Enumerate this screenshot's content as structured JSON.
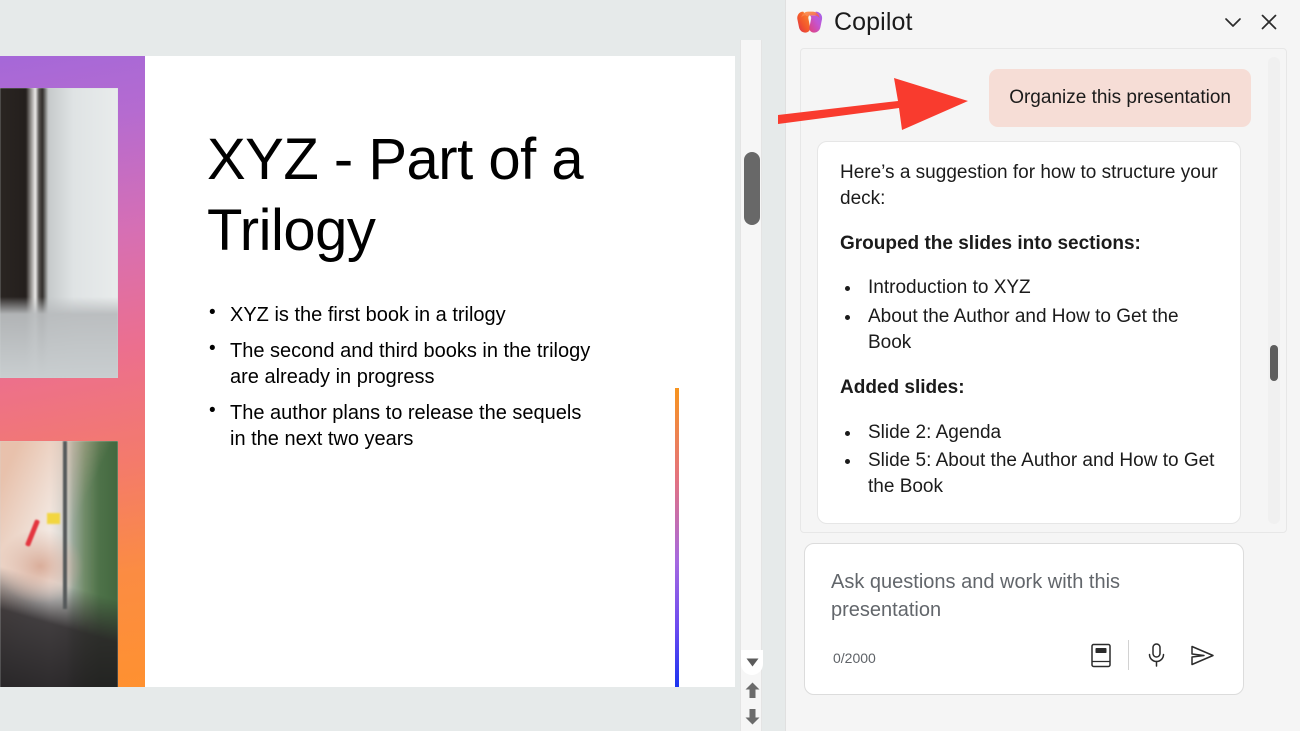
{
  "slide": {
    "title": "XYZ - Part of a Trilogy",
    "bullets": [
      "XYZ is the first book in a trilogy",
      "The second and third books in the trilogy are already in progress",
      "The author plans to release the sequels in the next two years"
    ],
    "accent_colors": {
      "rail_start": "#a568d8",
      "rail_mid": "#ec6f8e",
      "rail_end": "#ff9130",
      "line_top": "#f7941e",
      "line_bottom": "#1a34f0"
    }
  },
  "copilot": {
    "title": "Copilot",
    "minimize_label": "Minimize",
    "close_label": "Close",
    "user_message": "Organize this presentation",
    "bubble_color": "#f6ddd6",
    "response": {
      "intro": "Here’s a suggestion for how to structure your deck:",
      "section1_heading": "Grouped the slides into sections:",
      "section1_items": [
        "Introduction to XYZ",
        "About the Author and How to Get the Book"
      ],
      "section2_heading": "Added slides:",
      "section2_items": [
        "Slide 2: Agenda",
        "Slide 5: About the Author and How to Get the Book"
      ]
    },
    "composer": {
      "placeholder": "Ask questions and work with this presentation",
      "char_count": "0/2000",
      "prompt_guide_label": "Prompt guide",
      "mic_label": "Dictate",
      "send_label": "Send"
    }
  },
  "annotation": {
    "arrow_color": "#f93b2e",
    "points_to": "Organize this presentation"
  },
  "ppt_controls": {
    "scroll_down_label": "Scroll down",
    "previous_slide_label": "Previous slide",
    "next_slide_label": "Next slide"
  }
}
